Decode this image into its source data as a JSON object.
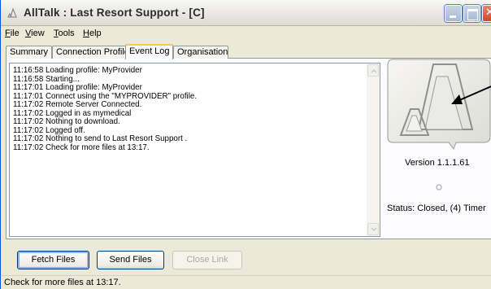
{
  "window": {
    "title": "AllTalk : Last Resort Support - [C]"
  },
  "menu": [
    {
      "label": "File",
      "underline": "F",
      "rest": "ile"
    },
    {
      "label": "View",
      "underline": "V",
      "rest": "iew"
    },
    {
      "label": "Tools",
      "underline": "T",
      "rest": "ools"
    },
    {
      "label": "Help",
      "underline": "H",
      "rest": "elp"
    }
  ],
  "tabs": [
    {
      "label": "Summary"
    },
    {
      "label": "Connection Profiles"
    },
    {
      "label": "Event Log",
      "active": true
    },
    {
      "label": "Organisation"
    }
  ],
  "event_log": [
    "11:16:58 Loading profile: MyProvider",
    "11:16:58 Starting...",
    "11:17:01 Loading profile: MyProvider",
    "11:17:01 Connect using the \"MYPROVIDER\" profile.",
    "11:17:02 Remote Server Connected.",
    "11:17:02 Logged in as mymedical",
    "11:17:02 Nothing to download.",
    "11:17:02 Logged off.",
    "11:17:02 Nothing to send to Last Resort Support .",
    "11:17:02 Check for more files at 13:17."
  ],
  "side": {
    "version": "Version 1.1.1.61",
    "status": "Status: Closed, (4)  Timer"
  },
  "buttons": {
    "fetch": "Fetch Files",
    "send": "Send Files",
    "close": "Close Link"
  },
  "statusbar": {
    "text": "Check for more files at 13:17."
  },
  "icons": {
    "app": "app-logo-icon",
    "minimize": "minimize-icon",
    "maximize": "maximize-icon",
    "close": "close-icon",
    "scroll_up": "scroll-up-arrow-icon",
    "scroll_down": "scroll-down-arrow-icon",
    "pointer": "arrow-pointer-icon"
  },
  "colors": {
    "window_bg": "#ece9d8",
    "border_blue": "#003c74",
    "active_tab_accent": "#ffc73c"
  }
}
